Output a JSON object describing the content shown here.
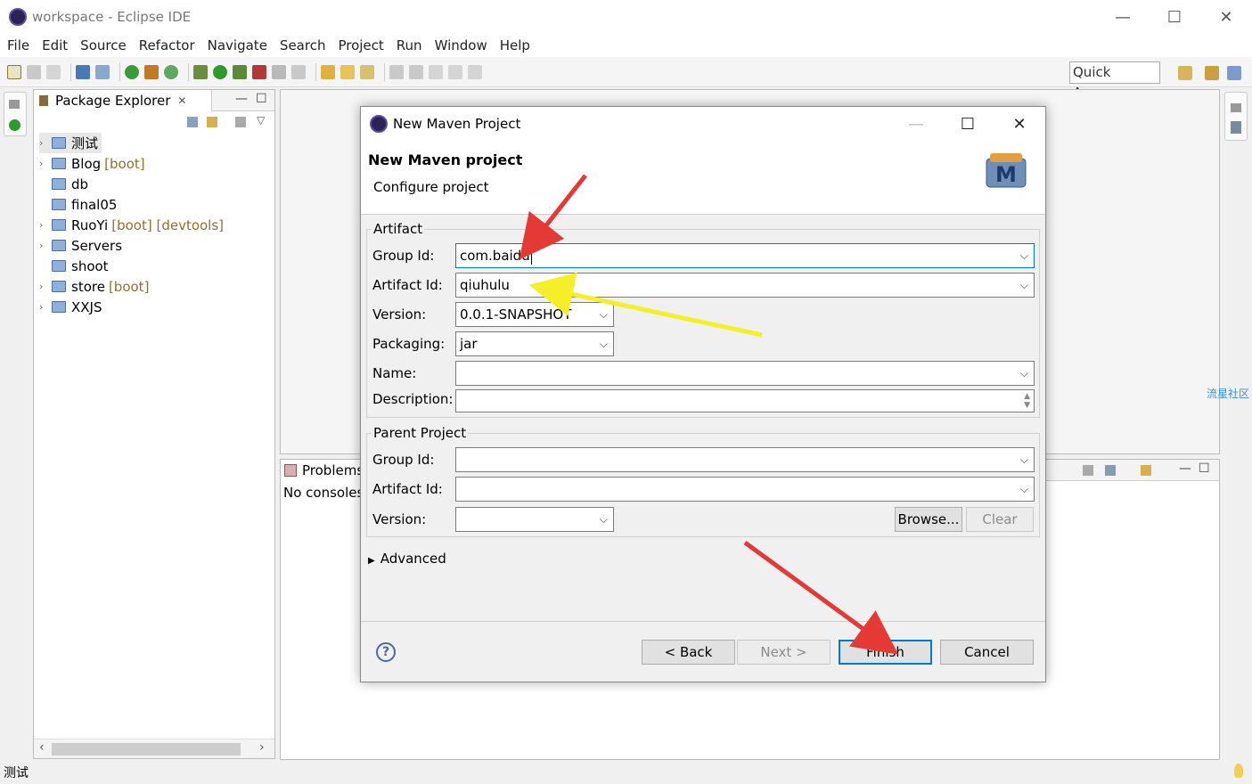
{
  "window": {
    "title": "workspace - Eclipse IDE"
  },
  "menu": [
    "File",
    "Edit",
    "Source",
    "Refactor",
    "Navigate",
    "Search",
    "Project",
    "Run",
    "Window",
    "Help"
  ],
  "toolbar": {
    "quick_access": "Quick Access"
  },
  "package_explorer": {
    "tab_label": "Package Explorer",
    "items": [
      {
        "name": "测试",
        "decor": "",
        "expandable": true
      },
      {
        "name": "Blog",
        "decor": "[boot]",
        "expandable": true
      },
      {
        "name": "db",
        "decor": "",
        "expandable": false
      },
      {
        "name": "final05",
        "decor": "",
        "expandable": false
      },
      {
        "name": "RuoYi",
        "decor": "[boot] [devtools]",
        "expandable": true
      },
      {
        "name": "Servers",
        "decor": "",
        "expandable": true
      },
      {
        "name": "shoot",
        "decor": "",
        "expandable": false
      },
      {
        "name": "store",
        "decor": "[boot]",
        "expandable": true
      },
      {
        "name": "XXJS",
        "decor": "",
        "expandable": true
      }
    ]
  },
  "console": {
    "tab_label": "Problems",
    "text": "No consoles"
  },
  "watermark": "流星社区",
  "status": {
    "text": "测试"
  },
  "dialog": {
    "title": "New Maven Project",
    "heading": "New Maven project",
    "subheading": "Configure project",
    "artifact_group": {
      "title": "Artifact",
      "group_id_label": "Group Id:",
      "group_id_value": "com.baidu",
      "artifact_id_label": "Artifact Id:",
      "artifact_id_value": "qiuhulu",
      "version_label": "Version:",
      "version_value": "0.0.1-SNAPSHOT",
      "packaging_label": "Packaging:",
      "packaging_value": "jar",
      "name_label": "Name:",
      "name_value": "",
      "description_label": "Description:",
      "description_value": ""
    },
    "parent_group": {
      "title": "Parent Project",
      "group_id_label": "Group Id:",
      "group_id_value": "",
      "artifact_id_label": "Artifact Id:",
      "artifact_id_value": "",
      "version_label": "Version:",
      "version_value": "",
      "browse_label": "Browse...",
      "clear_label": "Clear"
    },
    "advanced_label": "Advanced",
    "buttons": {
      "back": "< Back",
      "next": "Next >",
      "finish": "Finish",
      "cancel": "Cancel"
    },
    "help_glyph": "?"
  }
}
